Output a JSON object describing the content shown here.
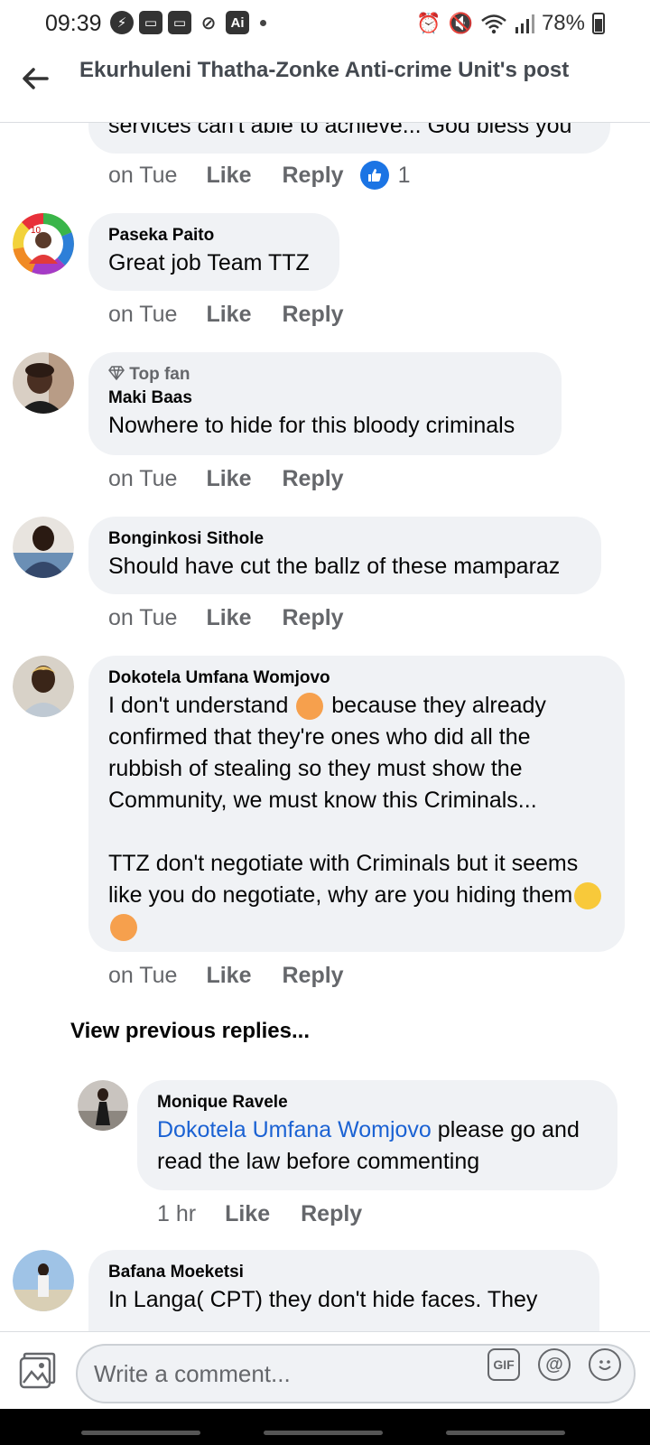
{
  "status_bar": {
    "time": "09:39",
    "battery": "78%",
    "left_icons": [
      "messenger-icon",
      "gallery-icon",
      "gallery-icon",
      "mute-icon",
      "ai-icon"
    ],
    "right_icons": [
      "alarm-icon",
      "vibrate-off-icon",
      "wifi-icon",
      "signal-icon",
      "battery-icon"
    ]
  },
  "header": {
    "title": "Ekurhuleni Thatha-Zonke Anti-crime Unit's post",
    "back_icon": "back-arrow-icon"
  },
  "comments": [
    {
      "partial": true,
      "text": "services can't able to achieve... God bless you",
      "time": "on Tue",
      "like": "Like",
      "reply": "Reply",
      "reactions": "1"
    },
    {
      "name": "Paseka Paito",
      "text": "Great job Team TTZ",
      "time": "on Tue",
      "like": "Like",
      "reply": "Reply"
    },
    {
      "badge": "Top fan",
      "name": "Maki Baas",
      "text": "Nowhere to hide for this bloody criminals",
      "time": "on Tue",
      "like": "Like",
      "reply": "Reply"
    },
    {
      "name": "Bonginkosi Sithole",
      "text": "Should have cut the ballz of these mamparaz",
      "time": "on Tue",
      "like": "Like",
      "reply": "Reply"
    },
    {
      "name": "Dokotela Umfana Womjovo",
      "text_part1": "I don't understand ",
      "text_part2": " because they already confirmed that they're ones who did all the rubbish of stealing so they must show the Community, we must know this Criminals...",
      "text_part3": "TTZ don't negotiate with Criminals but it seems like you do negotiate, why are you hiding them",
      "time": "on Tue",
      "like": "Like",
      "reply": "Reply"
    }
  ],
  "view_previous": "View previous replies...",
  "reply": {
    "name": "Monique Ravele",
    "mention": "Dokotela Umfana Womjovo",
    "text": " please go and read the law before commenting",
    "time": "1 hr",
    "like": "Like",
    "reply": "Reply"
  },
  "last_comment": {
    "name": "Bafana Moeketsi",
    "text": "In Langa( CPT) they don't hide faces. They"
  },
  "composer": {
    "placeholder": "Write a comment...",
    "gif_label": "GIF",
    "at_label": "@"
  },
  "colors": {
    "link": "#1b62d3",
    "like_blue": "#1b74e4",
    "bubble": "#f0f2f5",
    "meta": "#65676b"
  }
}
